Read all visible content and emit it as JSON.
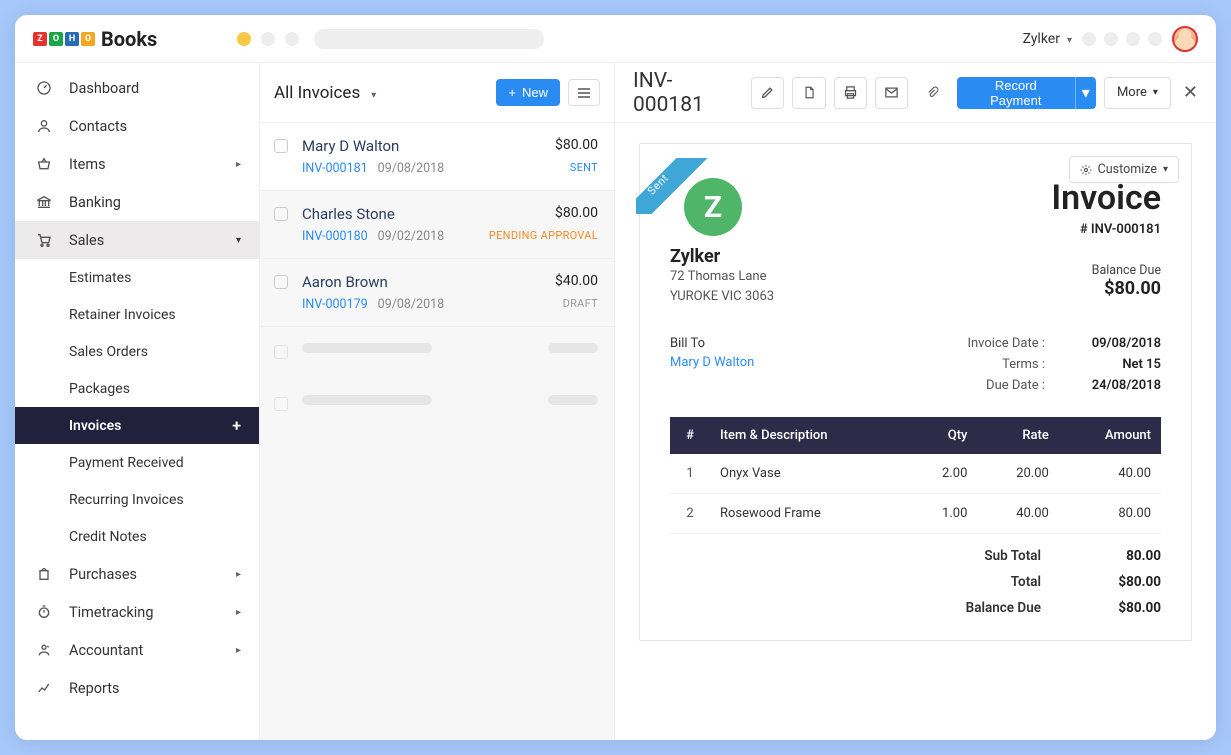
{
  "app": {
    "name": "Books",
    "logo_chars": [
      "Z",
      "O",
      "H",
      "O"
    ],
    "org_name": "Zylker"
  },
  "sidebar": {
    "items": [
      {
        "label": "Dashboard"
      },
      {
        "label": "Contacts"
      },
      {
        "label": "Items"
      },
      {
        "label": "Banking"
      },
      {
        "label": "Sales"
      },
      {
        "label": "Purchases"
      },
      {
        "label": "Timetracking"
      },
      {
        "label": "Accountant"
      },
      {
        "label": "Reports"
      }
    ],
    "sales_children": [
      {
        "label": "Estimates"
      },
      {
        "label": "Retainer Invoices"
      },
      {
        "label": "Sales Orders"
      },
      {
        "label": "Packages"
      },
      {
        "label": "Invoices"
      },
      {
        "label": "Payment Received"
      },
      {
        "label": "Recurring Invoices"
      },
      {
        "label": "Credit Notes"
      }
    ]
  },
  "list": {
    "title": "All Invoices",
    "new_label": "New",
    "rows": [
      {
        "name": "Mary D Walton",
        "amount": "$80.00",
        "num": "INV-000181",
        "date": "09/08/2018",
        "status": "SENT",
        "status_class": "st-sent"
      },
      {
        "name": "Charles Stone",
        "amount": "$80.00",
        "num": "INV-000180",
        "date": "09/02/2018",
        "status": "PENDING APPROVAL",
        "status_class": "st-pending"
      },
      {
        "name": "Aaron Brown",
        "amount": "$40.00",
        "num": "INV-000179",
        "date": "09/08/2018",
        "status": "DRAFT",
        "status_class": "st-draft"
      }
    ]
  },
  "detail": {
    "title": "INV-000181",
    "record_payment_label": "Record Payment",
    "more_label": "More",
    "customize_label": "Customize",
    "ribbon": "Sent"
  },
  "invoice": {
    "company": "Zylker",
    "address1": "72 Thomas Lane",
    "address2": "YUROKE VIC 3063",
    "doc_title": "Invoice",
    "doc_num": "# INV-000181",
    "balance_due_label": "Balance Due",
    "balance_due": "$80.00",
    "bill_to_label": "Bill To",
    "bill_to_name": "Mary D Walton",
    "meta": {
      "invoice_date_k": "Invoice Date :",
      "invoice_date_v": "09/08/2018",
      "terms_k": "Terms :",
      "terms_v": "Net 15",
      "due_k": "Due Date :",
      "due_v": "24/08/2018"
    },
    "cols": {
      "num": "#",
      "desc": "Item & Description",
      "qty": "Qty",
      "rate": "Rate",
      "amount": "Amount"
    },
    "lines": [
      {
        "n": "1",
        "desc": "Onyx Vase",
        "qty": "2.00",
        "rate": "20.00",
        "amount": "40.00"
      },
      {
        "n": "2",
        "desc": "Rosewood Frame",
        "qty": "1.00",
        "rate": "40.00",
        "amount": "80.00"
      }
    ],
    "totals": {
      "subtotal_k": "Sub Total",
      "subtotal_v": "80.00",
      "total_k": "Total",
      "total_v": "$80.00",
      "baldue_k": "Balance Due",
      "baldue_v": "$80.00"
    }
  }
}
